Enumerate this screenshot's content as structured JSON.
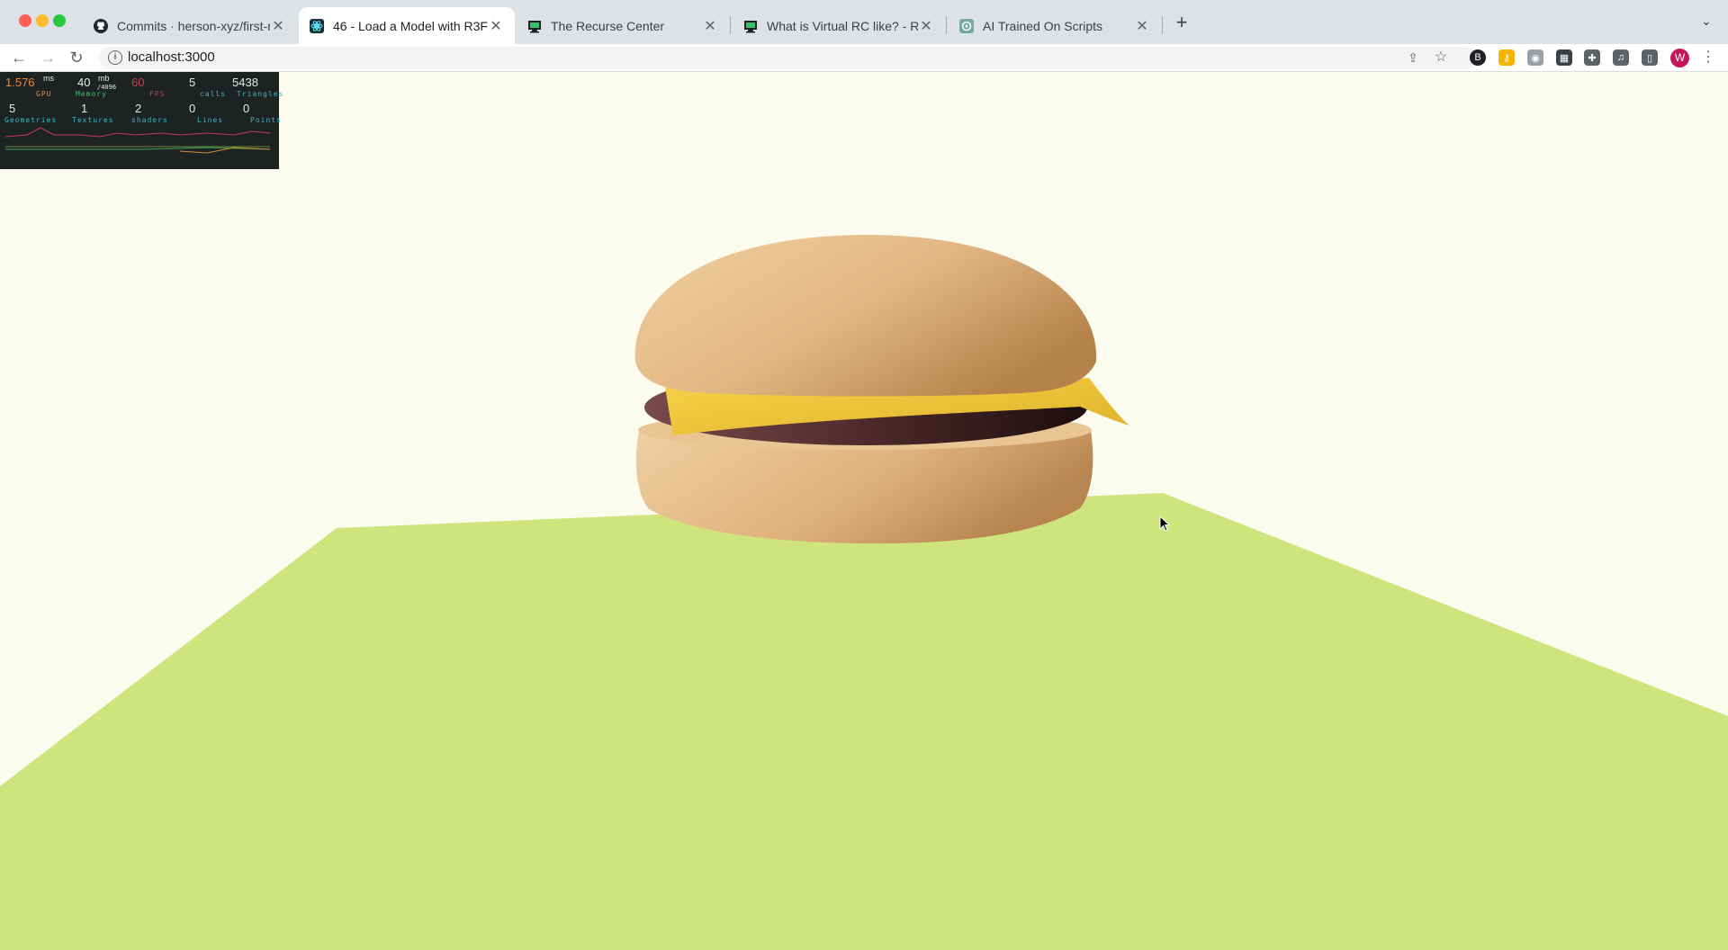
{
  "browser": {
    "tabs": [
      {
        "title": "Commits · herson-xyz/first-rea",
        "favicon": "github-icon",
        "active": false
      },
      {
        "title": "46 - Load a Model with R3F",
        "favicon": "r3f-icon",
        "active": true
      },
      {
        "title": "The Recurse Center",
        "favicon": "recurse-icon",
        "active": false
      },
      {
        "title": "What is Virtual RC like? - Recu",
        "favicon": "recurse-icon",
        "active": false
      },
      {
        "title": "AI Trained On Scripts",
        "favicon": "openai-icon",
        "active": false
      }
    ],
    "url": "localhost:3000",
    "profile_initial": "W"
  },
  "stats": {
    "gpu": {
      "value": "1.576",
      "unit": "ms",
      "label": "GPU"
    },
    "memory": {
      "value": "40",
      "unit": "mb",
      "sub": "/4096",
      "label": "Memory"
    },
    "fps": {
      "value": "60",
      "label": "FPS"
    },
    "calls": {
      "value": "5",
      "label": "calls"
    },
    "triangles": {
      "value": "5438",
      "label": "Triangles"
    },
    "geometries": {
      "value": "5",
      "label": "Geometries"
    },
    "textures": {
      "value": "1",
      "label": "Textures"
    },
    "shaders": {
      "value": "2",
      "label": "shaders"
    },
    "lines": {
      "value": "0",
      "label": "Lines"
    },
    "points": {
      "value": "0",
      "label": "Points"
    }
  },
  "scene": {
    "background": "#fcfcee",
    "floor_color": "#d0e47e",
    "bun_color": "#e3b986",
    "cheese_color": "#f2cd3c",
    "patty_color": "#4a2327",
    "model": "hamburger"
  }
}
